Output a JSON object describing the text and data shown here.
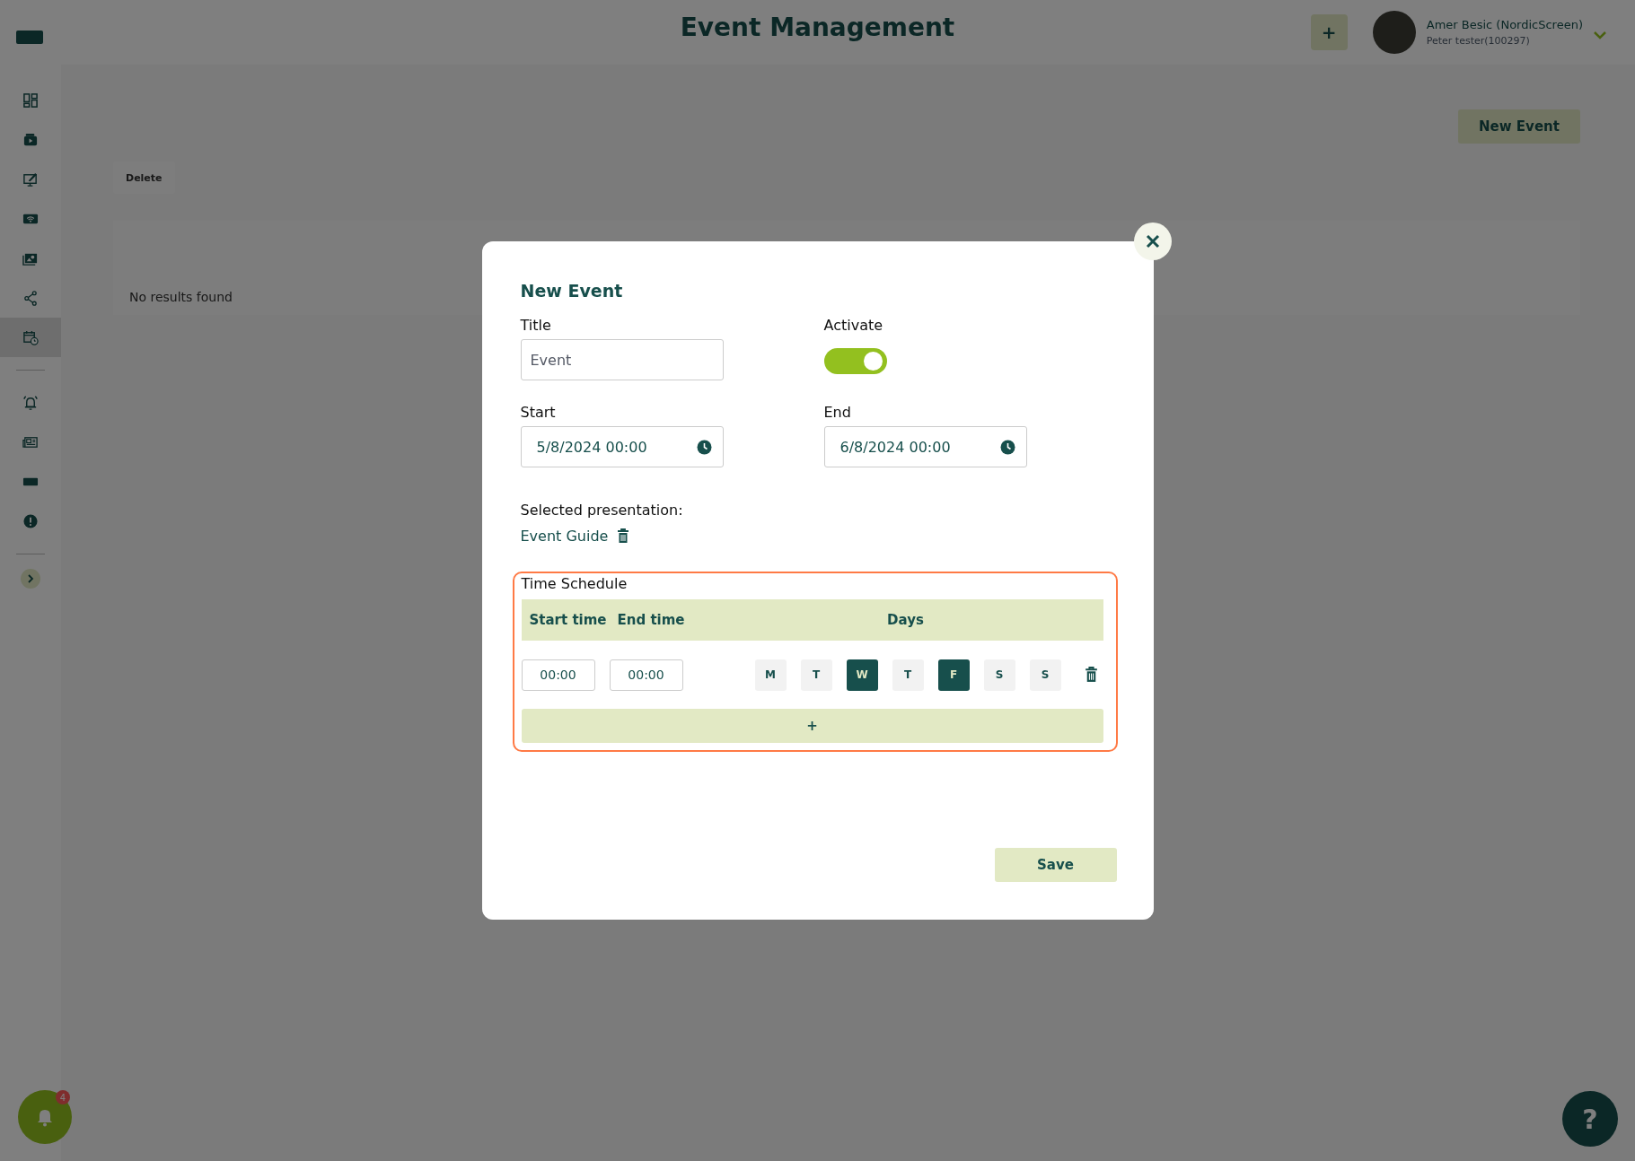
{
  "app_bar": {
    "title": "Event Management",
    "add_label": "+",
    "user": {
      "name": "Amer Besic (NordicScreen)",
      "account": "Peter tester(100297)"
    }
  },
  "sidebar": {
    "groups": [
      {
        "items": [
          {
            "kind": "grid",
            "selected": false
          },
          {
            "kind": "media",
            "selected": false
          },
          {
            "kind": "monitor",
            "selected": false
          },
          {
            "kind": "wifi",
            "selected": false
          },
          {
            "kind": "photo",
            "selected": false
          },
          {
            "kind": "share",
            "selected": false
          },
          {
            "kind": "calendar",
            "selected": true
          }
        ]
      },
      {
        "items": [
          {
            "kind": "bell",
            "selected": false
          },
          {
            "kind": "news",
            "selected": false
          },
          {
            "kind": "screen",
            "selected": false
          },
          {
            "kind": "alert",
            "selected": false
          }
        ]
      }
    ],
    "collapsed": true
  },
  "page": {
    "new_event_label": "New Event",
    "delete_label": "Delete",
    "empty_text": "No results found"
  },
  "dialog": {
    "heading": "New Event",
    "title_label": "Title",
    "title_value": "Event",
    "activate_label": "Activate",
    "activate_on": true,
    "start_label": "Start",
    "start_value": "5/8/2024 00:00",
    "end_label": "End",
    "end_value": "6/8/2024 00:00",
    "presentation_label": "Selected presentation:",
    "presentation_name": "Event Guide",
    "schedule": {
      "title": "Time Schedule",
      "columns": [
        "Start time",
        "End time",
        "Days"
      ],
      "rows": [
        {
          "start": "00:00",
          "end": "00:00",
          "days": [
            {
              "label": "M",
              "selected": false
            },
            {
              "label": "T",
              "selected": false
            },
            {
              "label": "W",
              "selected": true
            },
            {
              "label": "T",
              "selected": false
            },
            {
              "label": "F",
              "selected": true
            },
            {
              "label": "S",
              "selected": false
            },
            {
              "label": "S",
              "selected": false
            }
          ]
        }
      ],
      "add_label": "+"
    },
    "save_label": "Save"
  },
  "notifications": {
    "count": "4"
  },
  "help": {
    "label": "?"
  }
}
